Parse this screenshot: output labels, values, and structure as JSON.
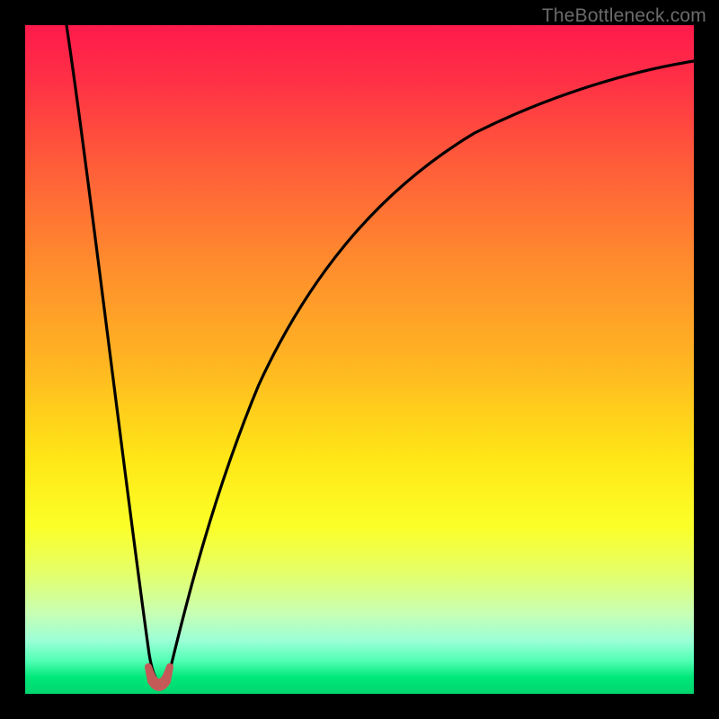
{
  "watermark": "TheBottleneck.com",
  "chart_data": {
    "type": "line",
    "title": "",
    "xlabel": "",
    "ylabel": "",
    "xlim": [
      0,
      100
    ],
    "ylim": [
      0,
      100
    ],
    "notch": {
      "x_percent": 20,
      "y_percent": 0,
      "width_percent": 3
    },
    "series": [
      {
        "name": "curve",
        "x": [
          6,
          8,
          10,
          12,
          14,
          16,
          18,
          19,
          20,
          21,
          22,
          24,
          28,
          34,
          42,
          52,
          64,
          78,
          92,
          100
        ],
        "y": [
          100,
          88,
          76,
          64,
          52,
          38,
          18,
          6,
          0,
          6,
          18,
          36,
          56,
          72,
          82,
          88,
          92,
          95,
          97,
          98
        ]
      }
    ]
  }
}
